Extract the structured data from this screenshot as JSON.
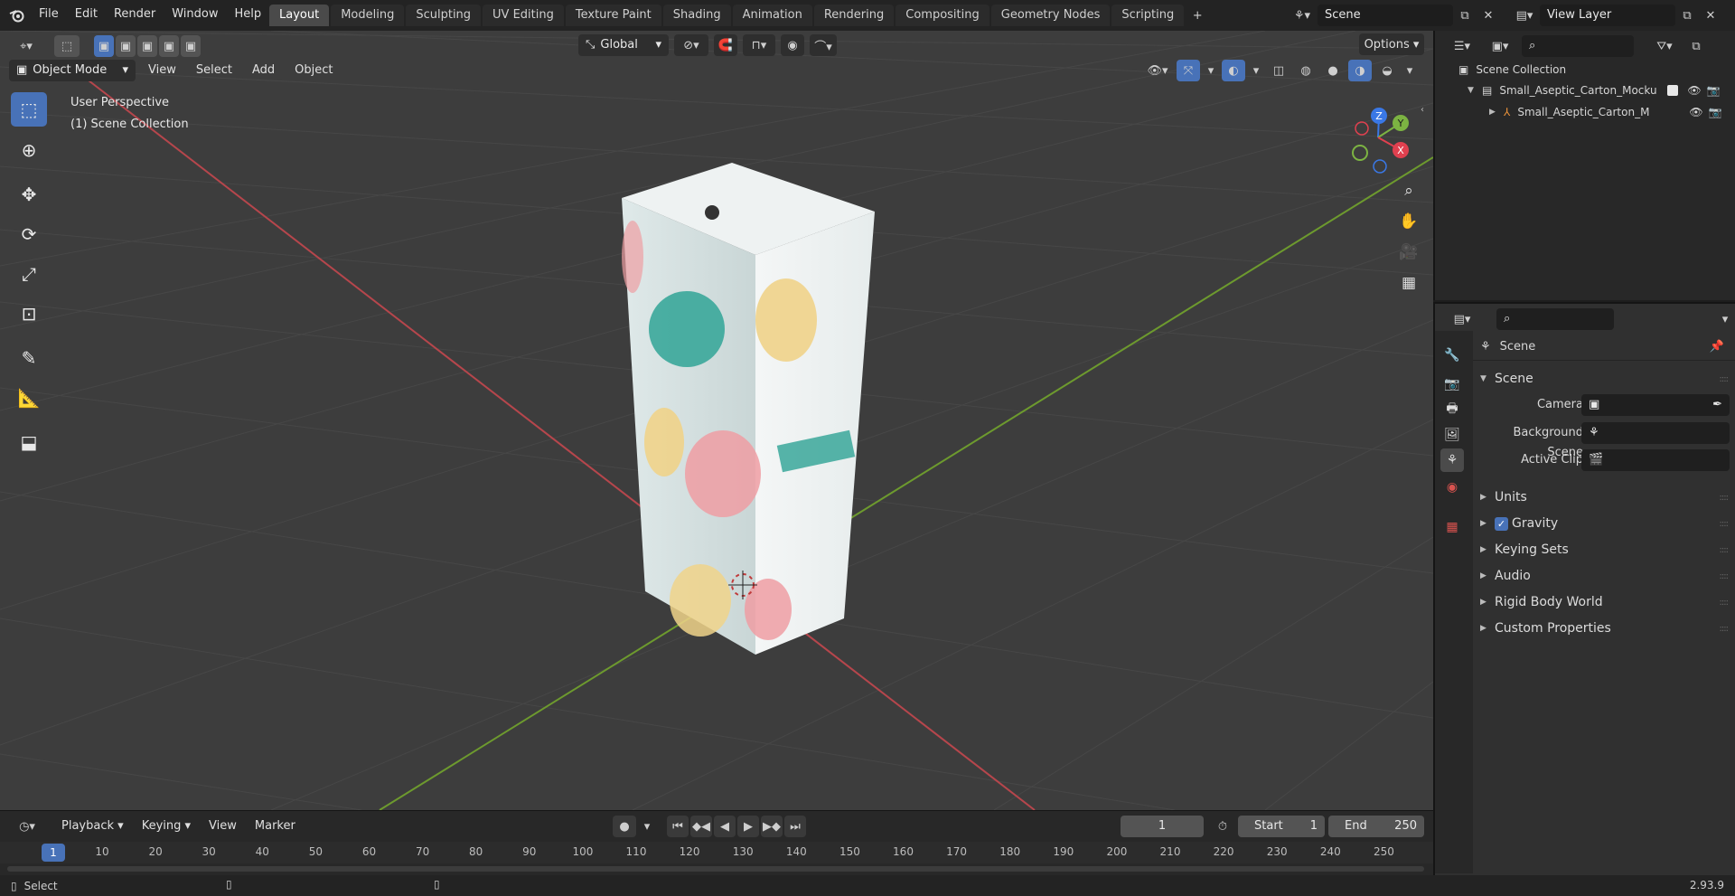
{
  "topbar": {
    "menus": [
      "File",
      "Edit",
      "Render",
      "Window",
      "Help"
    ],
    "workspaces": [
      "Layout",
      "Modeling",
      "Sculpting",
      "UV Editing",
      "Texture Paint",
      "Shading",
      "Animation",
      "Rendering",
      "Compositing",
      "Geometry Nodes",
      "Scripting"
    ],
    "active_workspace": "Layout",
    "scene_name": "Scene",
    "view_layer": "View Layer"
  },
  "viewport": {
    "mode": "Object Mode",
    "header_menus": [
      "View",
      "Select",
      "Add",
      "Object"
    ],
    "transform_orientation": "Global",
    "options_label": "Options",
    "overlay_text_1": "User Perspective",
    "overlay_text_2": "(1) Scene Collection",
    "gizmo": {
      "x": "X",
      "y": "Y",
      "z": "Z"
    }
  },
  "outliner": {
    "root": "Scene Collection",
    "collection": "Small_Aseptic_Carton_Mocku",
    "object": "Small_Aseptic_Carton_M"
  },
  "properties": {
    "context": "Scene",
    "panel_title": "Scene",
    "camera_label": "Camera",
    "background_scene_label": "Background Scene",
    "active_clip_label": "Active Clip",
    "subpanels": [
      "Units",
      "Gravity",
      "Keying Sets",
      "Audio",
      "Rigid Body World",
      "Custom Properties"
    ],
    "gravity_checked": true
  },
  "timeline": {
    "menus": [
      "Playback",
      "Keying",
      "View",
      "Marker"
    ],
    "current_frame": "1",
    "start_label": "Start",
    "start_value": "1",
    "end_label": "End",
    "end_value": "250",
    "ruler": [
      "10",
      "20",
      "30",
      "40",
      "50",
      "60",
      "70",
      "80",
      "90",
      "100",
      "110",
      "120",
      "130",
      "140",
      "150",
      "160",
      "170",
      "180",
      "190",
      "200",
      "210",
      "220",
      "230",
      "240",
      "250"
    ],
    "playhead": "1"
  },
  "status": {
    "left": "Select",
    "version": "2.93.9"
  },
  "colors": {
    "accent": "#4872b8",
    "x_axis": "#e0404f",
    "y_axis": "#7cb342",
    "z_axis": "#3a78e6"
  }
}
